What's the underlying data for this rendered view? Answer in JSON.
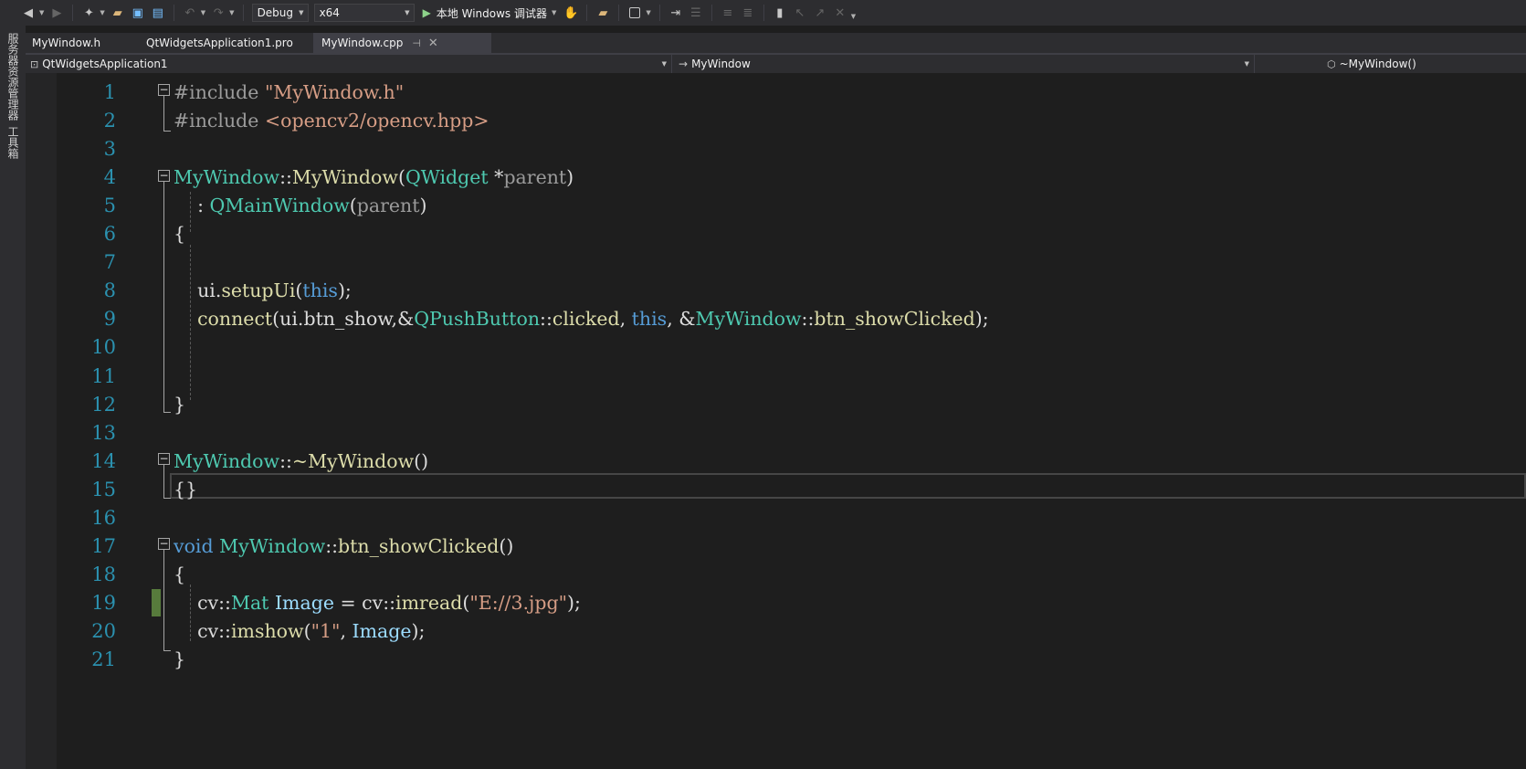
{
  "toolbar": {
    "configuration": "Debug",
    "platform": "x64",
    "run_label": "本地 Windows 调试器",
    "icons": [
      "back-icon",
      "forward-icon",
      "new-project-icon",
      "open-icon",
      "save-icon",
      "save-all-icon",
      "undo-icon",
      "redo-icon",
      "run-icon",
      "attach-icon",
      "folder-icon",
      "camera-icon",
      "step-icon",
      "comment-icon",
      "uncomment-icon",
      "bookmark-icon",
      "prev-bookmark-icon",
      "next-bookmark-icon",
      "clear-bookmark-icon",
      "overflow-icon"
    ]
  },
  "side_tabs": [
    "服务器资源管理器",
    "工具箱"
  ],
  "tabs": [
    {
      "label": "MyWindow.h",
      "active": false
    },
    {
      "label": "QtWidgetsApplication1.pro",
      "active": false
    },
    {
      "label": "MyWindow.cpp",
      "active": true
    }
  ],
  "nav": {
    "project": "QtWidgetsApplication1",
    "scope": "MyWindow",
    "member": "~MyWindow()"
  },
  "code": {
    "line_numbers": [
      "1",
      "2",
      "3",
      "4",
      "5",
      "6",
      "7",
      "8",
      "9",
      "10",
      "11",
      "12",
      "13",
      "14",
      "15",
      "16",
      "17",
      "18",
      "19",
      "20",
      "21"
    ],
    "lines": [
      [
        {
          "t": "#include ",
          "c": "pp"
        },
        {
          "t": "\"MyWindow.h\"",
          "c": "str"
        }
      ],
      [
        {
          "t": "#include ",
          "c": "pp"
        },
        {
          "t": "<opencv2/opencv.hpp>",
          "c": "str"
        }
      ],
      [],
      [
        {
          "t": "MyWindow",
          "c": "ty"
        },
        {
          "t": "::",
          "c": ""
        },
        {
          "t": "MyWindow",
          "c": "fn"
        },
        {
          "t": "(",
          "c": ""
        },
        {
          "t": "QWidget",
          "c": "ty"
        },
        {
          "t": " *",
          "c": ""
        },
        {
          "t": "parent",
          "c": "pa"
        },
        {
          "t": ")",
          "c": ""
        }
      ],
      [
        {
          "t": "    : ",
          "c": ""
        },
        {
          "t": "QMainWindow",
          "c": "ty"
        },
        {
          "t": "(",
          "c": ""
        },
        {
          "t": "parent",
          "c": "pa"
        },
        {
          "t": ")",
          "c": ""
        }
      ],
      [
        {
          "t": "{",
          "c": ""
        }
      ],
      [],
      [
        {
          "t": "    ui.",
          "c": ""
        },
        {
          "t": "setupUi",
          "c": "fn"
        },
        {
          "t": "(",
          "c": ""
        },
        {
          "t": "this",
          "c": "k"
        },
        {
          "t": ");",
          "c": ""
        }
      ],
      [
        {
          "t": "    ",
          "c": ""
        },
        {
          "t": "connect",
          "c": "fn"
        },
        {
          "t": "(ui.btn_show,&",
          "c": ""
        },
        {
          "t": "QPushButton",
          "c": "ty"
        },
        {
          "t": "::",
          "c": ""
        },
        {
          "t": "clicked",
          "c": "fn"
        },
        {
          "t": ", ",
          "c": ""
        },
        {
          "t": "this",
          "c": "k"
        },
        {
          "t": ", &",
          "c": ""
        },
        {
          "t": "MyWindow",
          "c": "ty"
        },
        {
          "t": "::",
          "c": ""
        },
        {
          "t": "btn_showClicked",
          "c": "fn"
        },
        {
          "t": ");",
          "c": ""
        }
      ],
      [],
      [],
      [
        {
          "t": "}",
          "c": ""
        }
      ],
      [],
      [
        {
          "t": "MyWindow",
          "c": "ty"
        },
        {
          "t": "::",
          "c": ""
        },
        {
          "t": "~MyWindow",
          "c": "fn"
        },
        {
          "t": "()",
          "c": ""
        }
      ],
      [
        {
          "t": "{}",
          "c": ""
        }
      ],
      [],
      [
        {
          "t": "void",
          "c": "k"
        },
        {
          "t": " ",
          "c": ""
        },
        {
          "t": "MyWindow",
          "c": "ty"
        },
        {
          "t": "::",
          "c": ""
        },
        {
          "t": "btn_showClicked",
          "c": "fn"
        },
        {
          "t": "()",
          "c": ""
        }
      ],
      [
        {
          "t": "{",
          "c": ""
        }
      ],
      [
        {
          "t": "    cv::",
          "c": ""
        },
        {
          "t": "Mat",
          "c": "ty"
        },
        {
          "t": " ",
          "c": ""
        },
        {
          "t": "Image",
          "c": "va"
        },
        {
          "t": " = cv::",
          "c": ""
        },
        {
          "t": "imread",
          "c": "fn"
        },
        {
          "t": "(",
          "c": ""
        },
        {
          "t": "\"E://3.jpg\"",
          "c": "str"
        },
        {
          "t": ");",
          "c": ""
        }
      ],
      [
        {
          "t": "    cv::",
          "c": ""
        },
        {
          "t": "imshow",
          "c": "fn"
        },
        {
          "t": "(",
          "c": ""
        },
        {
          "t": "\"1\"",
          "c": "str"
        },
        {
          "t": ", ",
          "c": ""
        },
        {
          "t": "Image",
          "c": "va"
        },
        {
          "t": ");",
          "c": ""
        }
      ],
      [
        {
          "t": "}",
          "c": ""
        }
      ]
    ]
  }
}
